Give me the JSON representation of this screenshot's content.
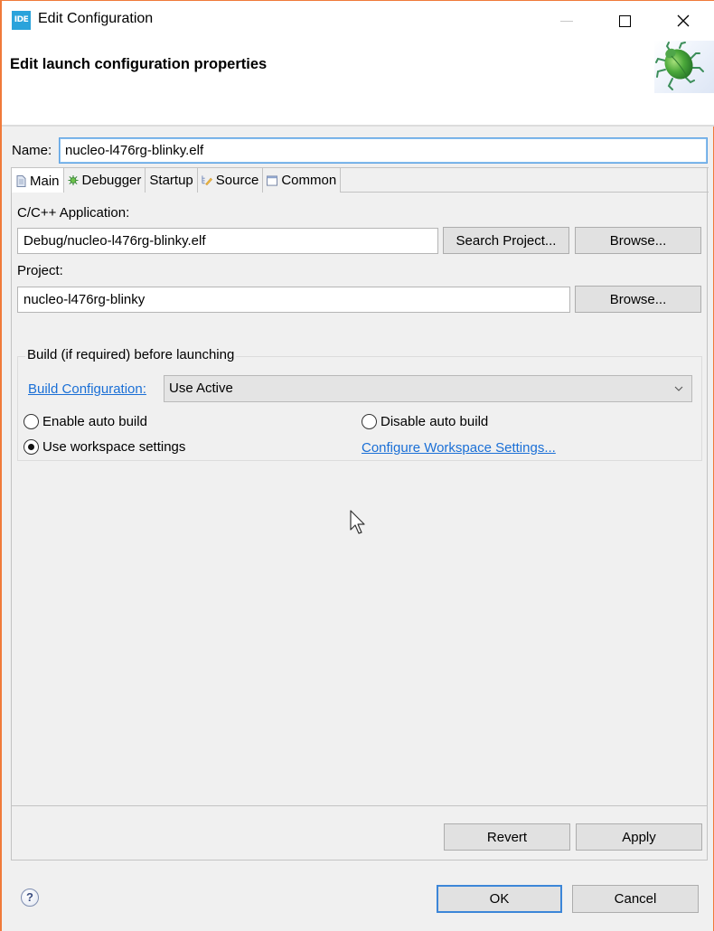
{
  "window": {
    "app_icon_text": "IDE",
    "title": "Edit Configuration",
    "controls": {
      "minimize": "minimize",
      "maximize": "maximize",
      "close": "close"
    }
  },
  "header": {
    "title": "Edit launch configuration properties",
    "banner_icon": "bug-icon"
  },
  "name": {
    "label": "Name:",
    "value": "nucleo-l476rg-blinky.elf"
  },
  "tabs": [
    {
      "label": "Main",
      "icon": "document-icon",
      "active": true
    },
    {
      "label": "Debugger",
      "icon": "bug-gear-icon",
      "active": false
    },
    {
      "label": "Startup",
      "icon": "",
      "active": false
    },
    {
      "label": "Source",
      "icon": "source-icon",
      "active": false
    },
    {
      "label": "Common",
      "icon": "window-icon",
      "active": false
    }
  ],
  "main": {
    "application": {
      "label": "C/C++ Application:",
      "value": "Debug/nucleo-l476rg-blinky.elf",
      "search_button": "Search Project...",
      "browse_button": "Browse..."
    },
    "project": {
      "label": "Project:",
      "value": "nucleo-l476rg-blinky",
      "browse_button": "Browse..."
    },
    "build": {
      "group_title": "Build (if required) before launching",
      "config_link": "Build Configuration:",
      "config_value": "Use Active",
      "radios": [
        {
          "label": "Enable auto build",
          "checked": false
        },
        {
          "label": "Disable auto build",
          "checked": false
        },
        {
          "label": "Use workspace settings",
          "checked": true
        }
      ],
      "workspace_link": "Configure Workspace Settings..."
    }
  },
  "actions": {
    "revert": "Revert",
    "apply": "Apply",
    "ok": "OK",
    "cancel": "Cancel",
    "help": "?"
  }
}
